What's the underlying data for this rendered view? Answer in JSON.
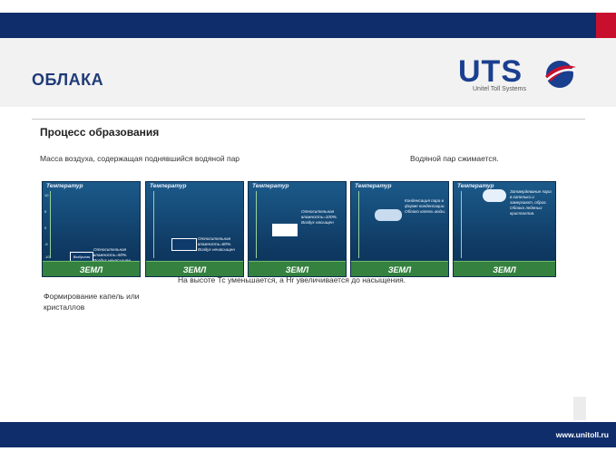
{
  "header": {
    "title": "ОБЛАКА",
    "logo_text": "UTS",
    "logo_subtitle": "Unitel Toll Systems"
  },
  "content": {
    "subtitle": "Процесс образования",
    "caption_left": "Масса воздуха, содержащая поднявшийся водяной пар",
    "caption_right": "Водяной пар сжимается.",
    "bottom_caption": "На высоте Тс уменьшается, а Нr увеличивается до насыщения.",
    "formation_text": "Формирование капель или кристаллов"
  },
  "panels": [
    {
      "title": "Температур",
      "ground": "ЗЕМЛ",
      "note": "Относительная влажность=50%. Воздух ненасыщен",
      "parcel_label": "Воздушная масса"
    },
    {
      "title": "Температур",
      "ground": "ЗЕМЛ",
      "note": "Относительная влажность=80%. Воздух ненасыщен"
    },
    {
      "title": "Температур",
      "ground": "ЗЕМЛ",
      "note": "Относительная влажность=100%. Воздух насыщен"
    },
    {
      "title": "Температур",
      "ground": "ЗЕМЛ",
      "note": "Конденсация пара в форме конденсации. Облако капель воды."
    },
    {
      "title": "Температур",
      "ground": "ЗЕМЛ",
      "note": "Затвердевание пара в капельки и замерзают, образ. Облака ледяных кристаллов."
    }
  ],
  "ticks": [
    "10",
    "5",
    "0",
    "-5",
    "-10"
  ],
  "footer": {
    "url": "www.unitoll.ru"
  },
  "colors": {
    "brand_blue": "#0f2d6b",
    "accent_red": "#c8102e",
    "ground_green": "#35813f"
  }
}
